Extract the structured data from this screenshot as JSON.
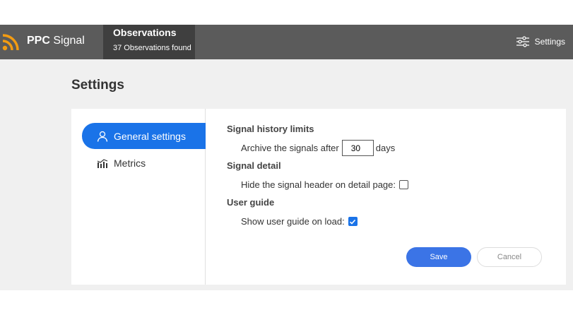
{
  "brand": {
    "name_bold": "PPC",
    "name_rest": " Signal",
    "accent_color": "#f39c12",
    "icon": "rss-feed-icon"
  },
  "header": {
    "observations_title": "Observations",
    "observations_count": "37 Observations found",
    "settings_label": "Settings",
    "settings_icon": "sliders-icon"
  },
  "page": {
    "title": "Settings"
  },
  "sidebar": {
    "items": [
      {
        "label": "General settings",
        "icon": "user-icon",
        "active": true
      },
      {
        "label": "Metrics",
        "icon": "chart-icon",
        "active": false
      }
    ]
  },
  "form": {
    "history_heading": "Signal history limits",
    "archive_label": "Archive the signals after",
    "archive_value": "30",
    "archive_unit": "days",
    "detail_heading": "Signal detail",
    "hide_header_label": "Hide the signal header on detail page:",
    "hide_header_checked": false,
    "guide_heading": "User guide",
    "show_guide_label": "Show user guide on load:",
    "show_guide_checked": true
  },
  "actions": {
    "save_label": "Save",
    "cancel_label": "Cancel"
  },
  "colors": {
    "navbar": "#5b5b5b",
    "tab_active": "#3f3f3f",
    "primary": "#1a73e8",
    "save": "#3b74e6"
  }
}
